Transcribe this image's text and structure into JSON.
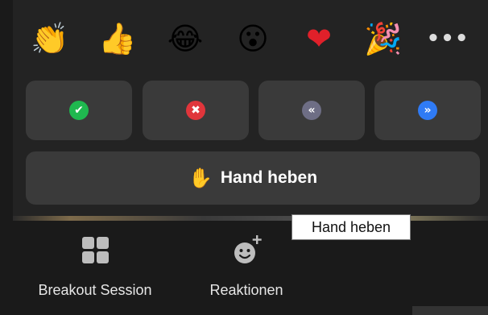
{
  "reactions": {
    "emojis": [
      {
        "name": "clapping-hands-icon",
        "glyph": "👏"
      },
      {
        "name": "thumbs-up-icon",
        "glyph": "👍"
      },
      {
        "name": "tears-of-joy-icon",
        "glyph": "😂"
      },
      {
        "name": "surprised-face-icon",
        "glyph": "😮"
      },
      {
        "name": "red-heart-icon",
        "glyph": "❤"
      },
      {
        "name": "party-popper-icon",
        "glyph": "🎉"
      }
    ],
    "more_label": "•••",
    "feedback": [
      {
        "name": "yes-check-icon",
        "glyph": "✔",
        "color": "#1fb84f"
      },
      {
        "name": "no-x-icon",
        "glyph": "✖",
        "color": "#e0353b"
      },
      {
        "name": "go-slower-icon",
        "glyph": "«",
        "color": "#6e6e85"
      },
      {
        "name": "go-faster-icon",
        "glyph": "»",
        "color": "#2f7bf5"
      }
    ],
    "raise_hand": {
      "icon": "✋",
      "label": "Hand heben"
    }
  },
  "toolbar": {
    "breakout_label": "Breakout Session",
    "reactions_label": "Reaktionen"
  },
  "tooltip": {
    "text": "Hand heben"
  },
  "colors": {
    "panel": "#232323",
    "button": "#3a3a3a",
    "toolbar": "#1a1a1a"
  }
}
